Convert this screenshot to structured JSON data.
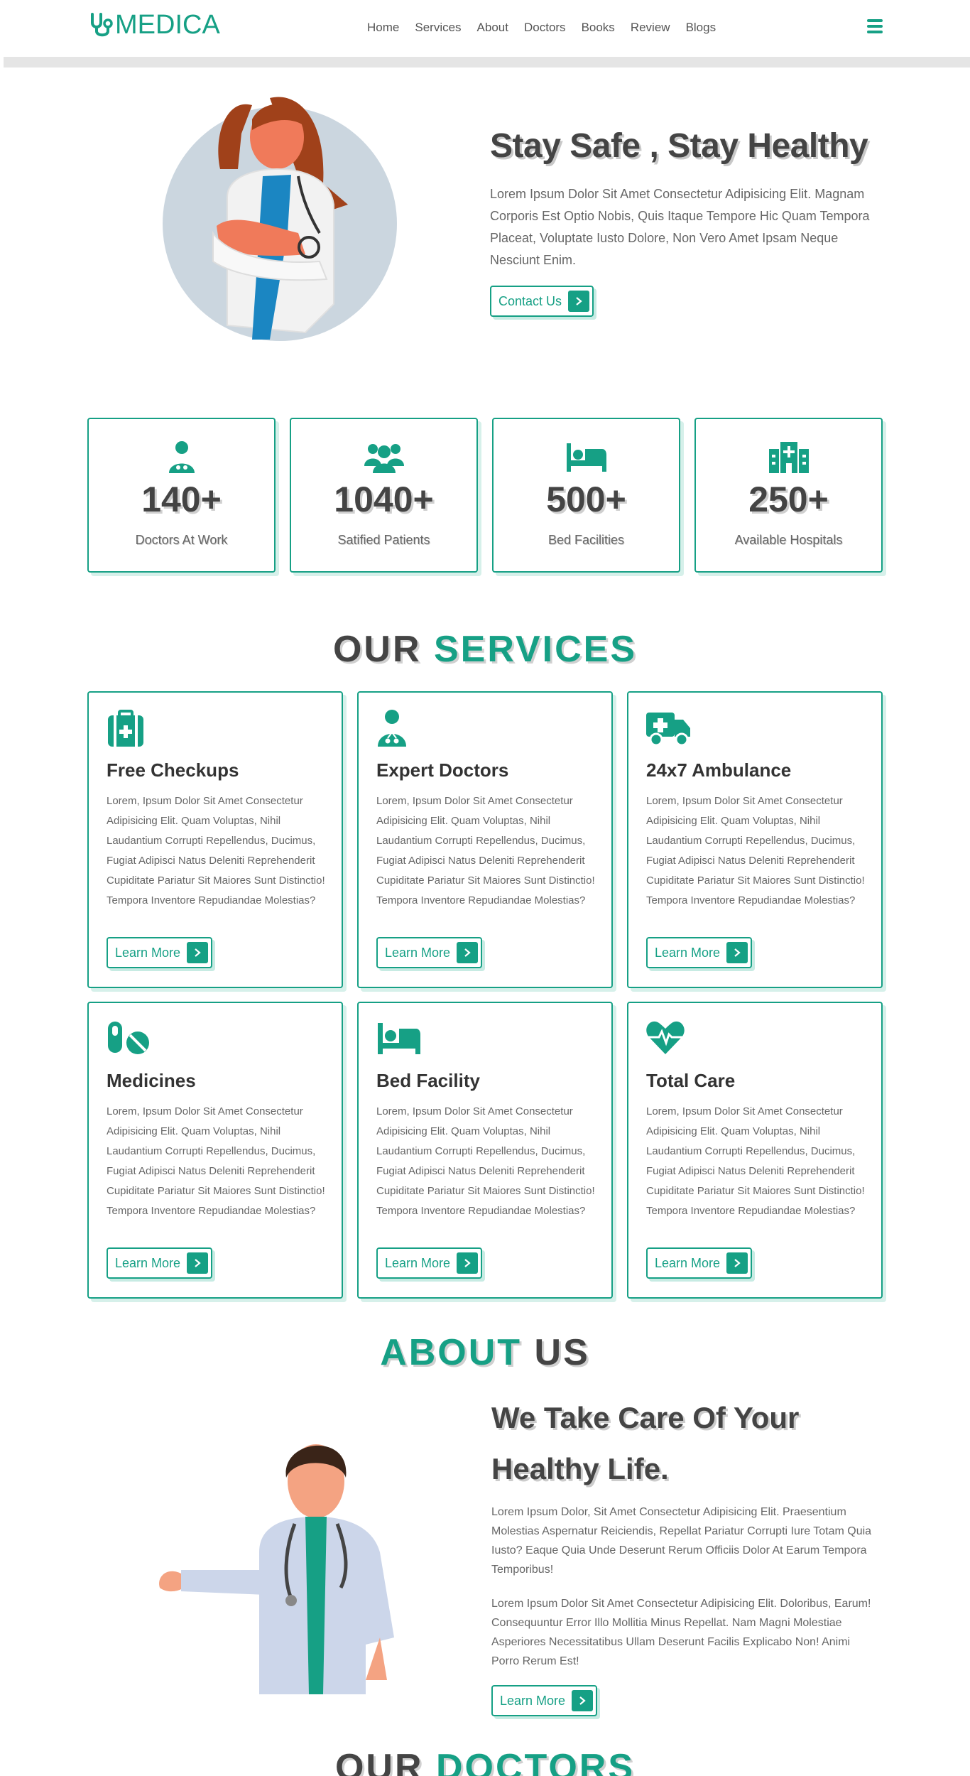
{
  "brand": {
    "name": "MEDICA",
    "accent": "#16a085",
    "dark": "#444444"
  },
  "nav": [
    "Home",
    "Services",
    "About",
    "Doctors",
    "Books",
    "Review",
    "Blogs"
  ],
  "hero": {
    "title": "Stay Safe , Stay Healthy",
    "text": "Lorem Ipsum Dolor Sit Amet Consectetur Adipisicing Elit. Magnam Corporis Est Optio Nobis, Quis Itaque Tempore Hic Quam Tempora Placeat, Voluptate Iusto Dolore, Non Vero Amet Ipsam Neque Nesciunt Enim.",
    "button": "Contact Us"
  },
  "stats": [
    {
      "icon": "doctor-icon",
      "number": "140+",
      "label": "Doctors At Work"
    },
    {
      "icon": "patients-icon",
      "number": "1040+",
      "label": "Satified Patients"
    },
    {
      "icon": "bed-icon",
      "number": "500+",
      "label": "Bed Facilities"
    },
    {
      "icon": "hospital-icon",
      "number": "250+",
      "label": "Available Hospitals"
    }
  ],
  "services": {
    "heading_dark": "OUR",
    "heading_green": "SERVICES",
    "items": [
      {
        "icon": "medkit-icon",
        "title": "Free Checkups",
        "text": "Lorem, Ipsum Dolor Sit Amet Consectetur Adipisicing Elit. Quam Voluptas, Nihil Laudantium Corrupti Repellendus, Ducimus, Fugiat Adipisci Natus Deleniti Reprehenderit Cupiditate Pariatur Sit Maiores Sunt Distinctio! Tempora Inventore Repudiandae Molestias?",
        "button": "Learn More"
      },
      {
        "icon": "doctor-icon",
        "title": "Expert Doctors",
        "text": "Lorem, Ipsum Dolor Sit Amet Consectetur Adipisicing Elit. Quam Voluptas, Nihil Laudantium Corrupti Repellendus, Ducimus, Fugiat Adipisci Natus Deleniti Reprehenderit Cupiditate Pariatur Sit Maiores Sunt Distinctio! Tempora Inventore Repudiandae Molestias?",
        "button": "Learn More"
      },
      {
        "icon": "ambulance-icon",
        "title": "24x7 Ambulance",
        "text": "Lorem, Ipsum Dolor Sit Amet Consectetur Adipisicing Elit. Quam Voluptas, Nihil Laudantium Corrupti Repellendus, Ducimus, Fugiat Adipisci Natus Deleniti Reprehenderit Cupiditate Pariatur Sit Maiores Sunt Distinctio! Tempora Inventore Repudiandae Molestias?",
        "button": "Learn More"
      },
      {
        "icon": "pills-icon",
        "title": "Medicines",
        "text": "Lorem, Ipsum Dolor Sit Amet Consectetur Adipisicing Elit. Quam Voluptas, Nihil Laudantium Corrupti Repellendus, Ducimus, Fugiat Adipisci Natus Deleniti Reprehenderit Cupiditate Pariatur Sit Maiores Sunt Distinctio! Tempora Inventore Repudiandae Molestias?",
        "button": "Learn More"
      },
      {
        "icon": "bed-icon",
        "title": "Bed Facility",
        "text": "Lorem, Ipsum Dolor Sit Amet Consectetur Adipisicing Elit. Quam Voluptas, Nihil Laudantium Corrupti Repellendus, Ducimus, Fugiat Adipisci Natus Deleniti Reprehenderit Cupiditate Pariatur Sit Maiores Sunt Distinctio! Tempora Inventore Repudiandae Molestias?",
        "button": "Learn More"
      },
      {
        "icon": "heartbeat-icon",
        "title": "Total Care",
        "text": "Lorem, Ipsum Dolor Sit Amet Consectetur Adipisicing Elit. Quam Voluptas, Nihil Laudantium Corrupti Repellendus, Ducimus, Fugiat Adipisci Natus Deleniti Reprehenderit Cupiditate Pariatur Sit Maiores Sunt Distinctio! Tempora Inventore Repudiandae Molestias?",
        "button": "Learn More"
      }
    ]
  },
  "about": {
    "heading_green": "ABOUT",
    "heading_dark": "US",
    "title": "We Take Care Of Your Healthy Life.",
    "p1": "Lorem Ipsum Dolor, Sit Amet Consectetur Adipisicing Elit. Praesentium Molestias Aspernatur Reiciendis, Repellat Pariatur Corrupti Iure Totam Quia Iusto? Eaque Quia Unde Deserunt Rerum Officiis Dolor At Earum Tempora Temporibus!",
    "p2": "Lorem Ipsum Dolor Sit Amet Consectetur Adipisicing Elit. Doloribus, Earum! Consequuntur Error Illo Mollitia Minus Repellat. Nam Magni Molestiae Asperiores Necessitatibus Ullam Deserunt Facilis Explicabo Non! Animi Porro Rerum Est!",
    "button": "Learn More"
  },
  "doctors": {
    "heading_dark": "OUR",
    "heading_green": "DOCTORS"
  }
}
